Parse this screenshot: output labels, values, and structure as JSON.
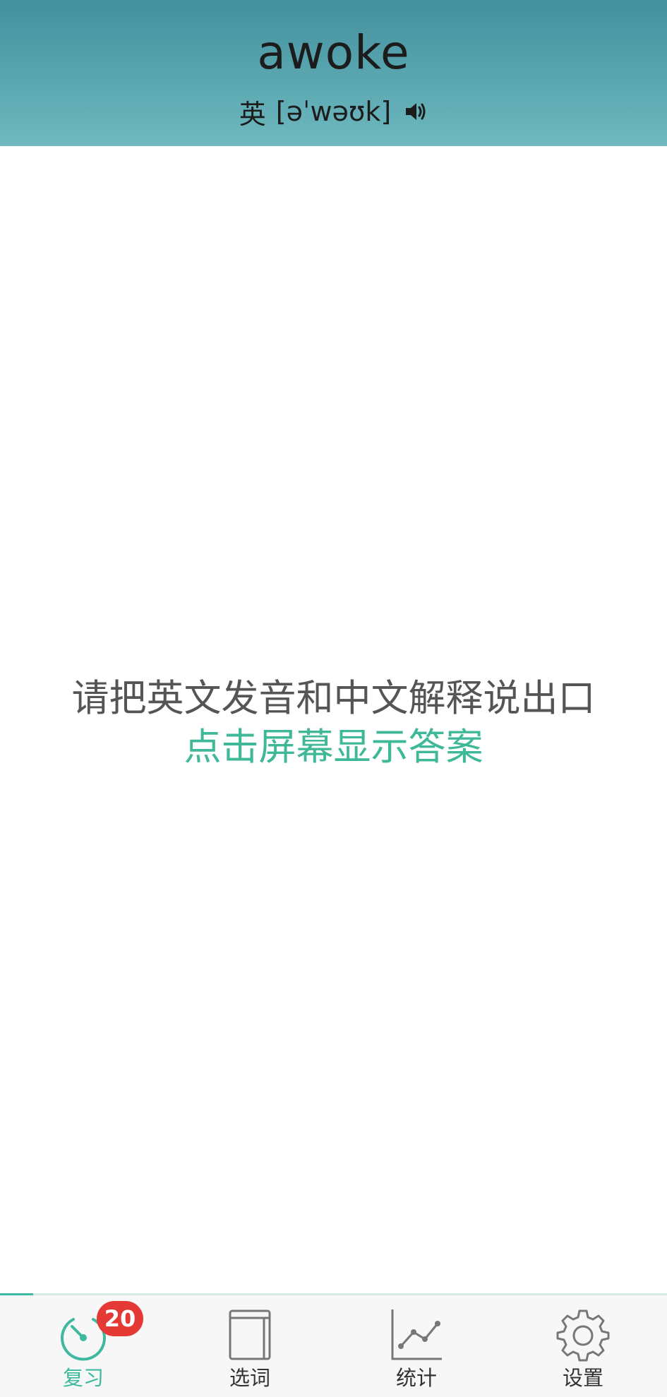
{
  "header": {
    "word": "awoke",
    "accent_label": "英",
    "phonetic": "[əˈwəʊk]",
    "speaker_icon": "speaker-icon"
  },
  "content": {
    "prompt": "请把英文发音和中文解释说出口",
    "reveal_hint": "点击屏幕显示答案"
  },
  "tabbar": {
    "tabs": [
      {
        "label": "复习",
        "icon": "timer-icon",
        "active": true,
        "badge": "20"
      },
      {
        "label": "选词",
        "icon": "book-icon",
        "active": false
      },
      {
        "label": "统计",
        "icon": "line-chart-icon",
        "active": false
      },
      {
        "label": "设置",
        "icon": "gear-icon",
        "active": false
      }
    ]
  },
  "colors": {
    "header_gradient_top": "#43909e",
    "header_gradient_bottom": "#6fb9be",
    "accent": "#3fb8a0",
    "prompt_text": "#555555",
    "badge": "#e53935"
  }
}
